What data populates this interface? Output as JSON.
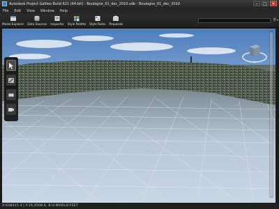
{
  "window": {
    "title": "Autodesk Project Galileo Build 621 (64-bit) - Boulogne_01_dec_2010.sdb - Boulogne_01_dec_2010",
    "minimize": "–",
    "maximize": "□",
    "close": "✕"
  },
  "menu": {
    "items": [
      "File",
      "Edit",
      "View",
      "Window",
      "Help"
    ]
  },
  "toolbar": {
    "tools": [
      {
        "label": "Model Explorer",
        "icon": "model-explorer-icon"
      },
      {
        "label": "Data Sources",
        "icon": "data-sources-icon"
      },
      {
        "label": "Inspector",
        "icon": "inspector-icon"
      },
      {
        "label": "Style Palette",
        "icon": "style-palette-icon"
      },
      {
        "label": "Style Rules",
        "icon": "style-rules-icon"
      },
      {
        "label": "Proposals",
        "icon": "proposals-icon"
      }
    ],
    "search_icon": "⚲",
    "search_chevron": "▾"
  },
  "palette": {
    "tools": [
      "select-tool-icon",
      "draw-tool-icon",
      "layer-tool-icon",
      "camera-tool-icon"
    ]
  },
  "statusbar": {
    "text": "X:648415.4 | Y:16,4508.6, B:U:WORLD:FEET"
  },
  "colors": {
    "accent": "#3a7fd0",
    "sky_top": "#5a86be",
    "sky_bottom": "#dfe8f3",
    "terrain_dark": "#3f4a3e",
    "mesh": "#e8eef7"
  }
}
